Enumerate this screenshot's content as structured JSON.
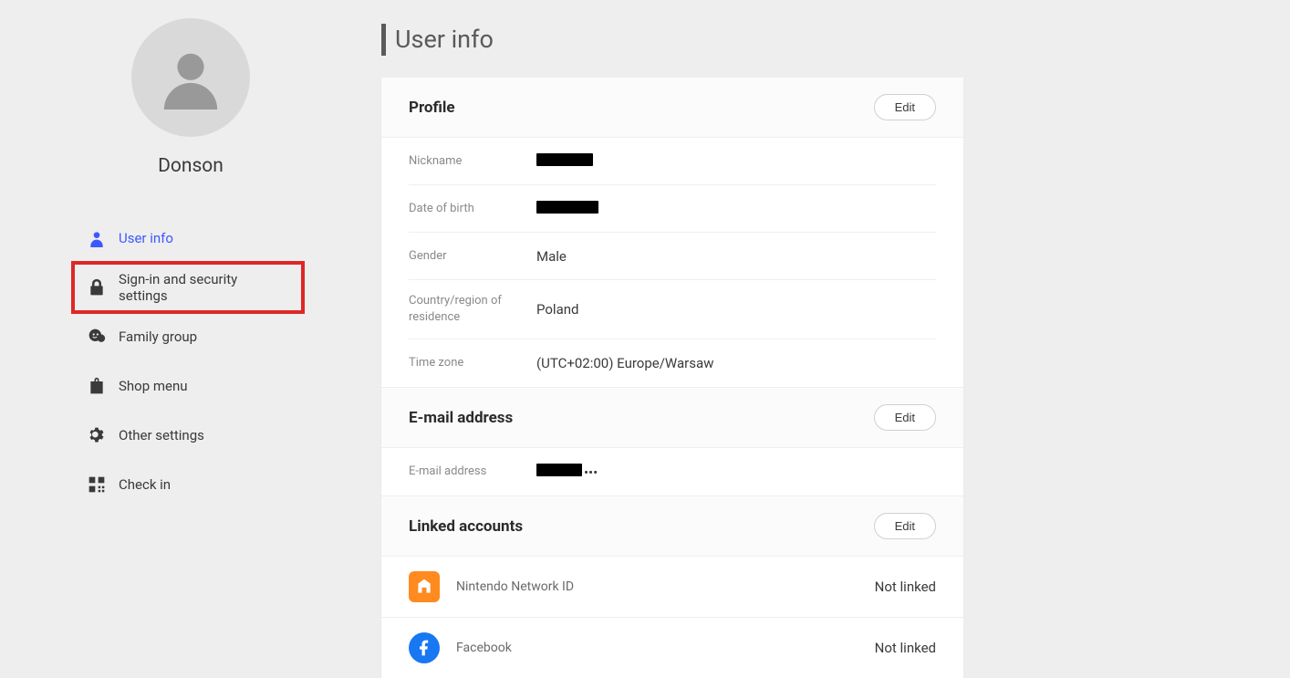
{
  "user": {
    "name": "Donson"
  },
  "nav": {
    "userInfo": "User info",
    "security": "Sign-in and security settings",
    "family": "Family group",
    "shop": "Shop menu",
    "other": "Other settings",
    "checkin": "Check in"
  },
  "page": {
    "title": "User info"
  },
  "sections": {
    "profile": {
      "title": "Profile",
      "edit": "Edit",
      "fields": {
        "nicknameLabel": "Nickname",
        "dobLabel": "Date of birth",
        "genderLabel": "Gender",
        "genderValue": "Male",
        "countryLabel": "Country/region of residence",
        "countryValue": "Poland",
        "tzLabel": "Time zone",
        "tzValue": "(UTC+02:00) Europe/Warsaw"
      }
    },
    "email": {
      "title": "E-mail address",
      "edit": "Edit",
      "fields": {
        "emailLabel": "E-mail address",
        "emailSuffix": "•••"
      }
    },
    "linked": {
      "title": "Linked accounts",
      "edit": "Edit",
      "items": [
        {
          "name": "Nintendo Network ID",
          "status": "Not linked"
        },
        {
          "name": "Facebook",
          "status": "Not linked"
        }
      ]
    }
  }
}
